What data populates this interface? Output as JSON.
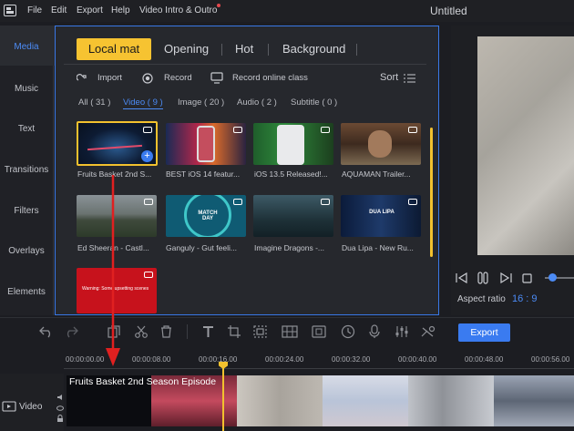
{
  "menu": {
    "items": [
      "File",
      "Edit",
      "Export",
      "Help",
      "Video Intro & Outro"
    ],
    "title": "Untitled"
  },
  "nav": {
    "items": [
      "Media",
      "Music",
      "Text",
      "Transitions",
      "Filters",
      "Overlays",
      "Elements"
    ]
  },
  "tabs": [
    "Local mat",
    "Opening",
    "Hot",
    "Background"
  ],
  "tools": {
    "import": "Import",
    "record": "Record",
    "record_online": "Record online class",
    "sort": "Sort"
  },
  "filters": [
    "All ( 31 )",
    "Video ( 9 )",
    "Image ( 20 )",
    "Audio ( 2 )",
    "Subtitle ( 0 )"
  ],
  "media_items": [
    {
      "label": "Fruits Basket 2nd S..."
    },
    {
      "label": "BEST iOS 14 featur..."
    },
    {
      "label": "iOS 13.5 Released!..."
    },
    {
      "label": "AQUAMAN Trailer..."
    },
    {
      "label": "Ed Sheeran - Castl..."
    },
    {
      "label": "Ganguly - Gut feeli..."
    },
    {
      "label": "Imagine Dragons -..."
    },
    {
      "label": "Dua Lipa - New Ru..."
    },
    {
      "label": ""
    }
  ],
  "thumb_texts": {
    "match_day": "MATCH DAY",
    "dua_lipa": "DUA LIPA",
    "warning": "Warning: Some upsetting scenes"
  },
  "preview": {
    "aspect_label": "Aspect ratio",
    "aspect_value": "16 : 9"
  },
  "toolbar": {
    "export_label": "Export"
  },
  "timeline": {
    "ticks": [
      "00:00:00.00",
      "00:00:08.00",
      "00:00:16.00",
      "00:00:24.00",
      "00:00:32.00",
      "00:00:40.00",
      "00:00:48.00",
      "00:00:56.00"
    ],
    "track_label": "Video",
    "clip_title": "Fruits Basket 2nd Season Episode"
  },
  "colors": {
    "accent": "#f6c331",
    "blue": "#3a7bf0",
    "arrow": "#e02020"
  }
}
